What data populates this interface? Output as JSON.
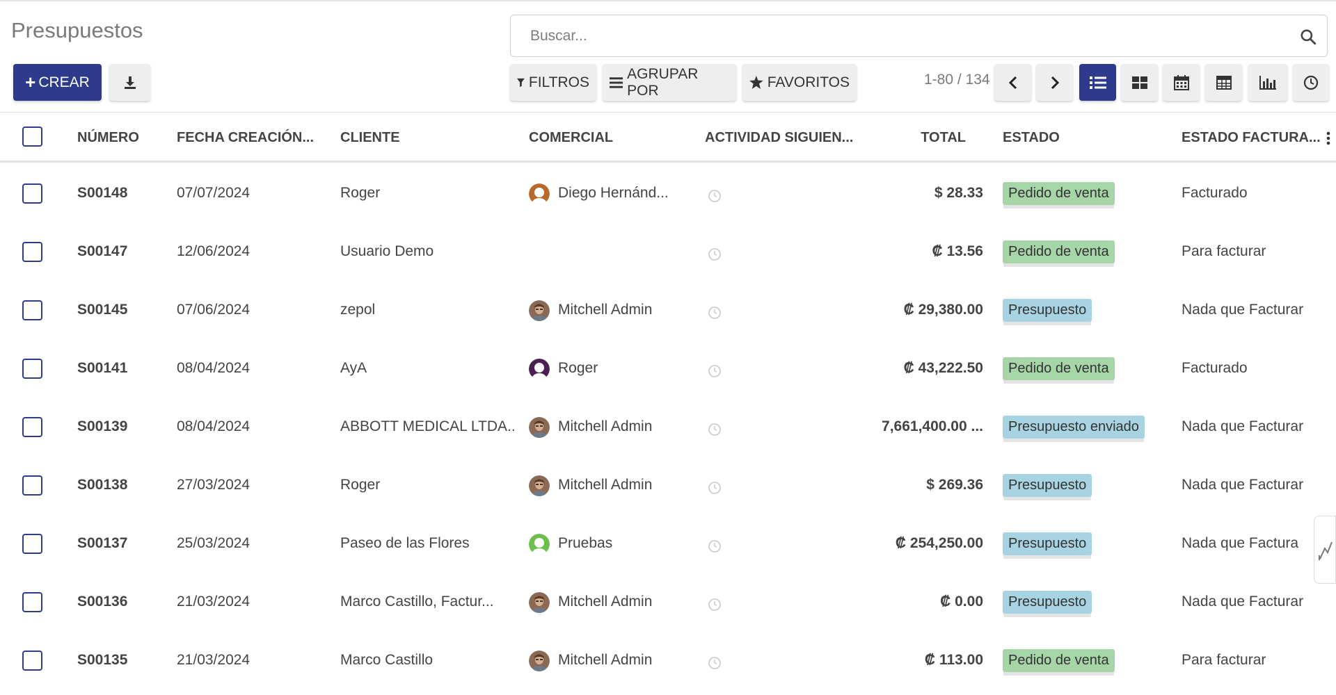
{
  "page": {
    "title": "Presupuestos"
  },
  "search": {
    "placeholder": "Buscar..."
  },
  "toolbar": {
    "create_label": "CREAR",
    "filters_label": "FILTROS",
    "groupby_label": "AGRUPAR POR",
    "favorites_label": "FAVORITOS",
    "pager_text": "1-80 / 134",
    "accent_color": "#2e3b8c"
  },
  "table": {
    "headers": {
      "number": "NÚMERO",
      "created": "FECHA CREACIÓN...",
      "customer": "CLIENTE",
      "salesperson": "COMERCIAL",
      "activity": "ACTIVIDAD SIGUIEN...",
      "total": "TOTAL",
      "status": "ESTADO",
      "invoice_status": "ESTADO FACTURA..."
    },
    "rows": [
      {
        "number": "S00148",
        "date": "07/07/2024",
        "customer": "Roger",
        "salesperson": "Diego Hernánd...",
        "avatar": "orange-user",
        "total": "$ 28.33",
        "status": "Pedido de venta",
        "status_color": "#a6d5a8",
        "invoice": "Facturado"
      },
      {
        "number": "S00147",
        "date": "12/06/2024",
        "customer": "Usuario Demo",
        "salesperson": "",
        "avatar": "",
        "total": "₡ 13.56",
        "status": "Pedido de venta",
        "status_color": "#a6d5a8",
        "invoice": "Para facturar"
      },
      {
        "number": "S00145",
        "date": "07/06/2024",
        "customer": "zepol",
        "salesperson": "Mitchell Admin",
        "avatar": "photo",
        "total": "₡ 29,380.00",
        "status": "Presupuesto",
        "status_color": "#a7d3e2",
        "invoice": "Nada que Facturar"
      },
      {
        "number": "S00141",
        "date": "08/04/2024",
        "customer": "AyA",
        "salesperson": "Roger",
        "avatar": "purple-user",
        "total": "₡ 43,222.50",
        "status": "Pedido de venta",
        "status_color": "#a6d5a8",
        "invoice": "Facturado"
      },
      {
        "number": "S00139",
        "date": "08/04/2024",
        "customer": "ABBOTT MEDICAL LTDA...",
        "salesperson": "Mitchell Admin",
        "avatar": "photo",
        "total": "7,661,400.00 ...",
        "status": "Presupuesto enviado",
        "status_color": "#a7d3e2",
        "invoice": "Nada que Facturar"
      },
      {
        "number": "S00138",
        "date": "27/03/2024",
        "customer": "Roger",
        "salesperson": "Mitchell Admin",
        "avatar": "photo",
        "total": "$ 269.36",
        "status": "Presupuesto",
        "status_color": "#a7d3e2",
        "invoice": "Nada que Facturar"
      },
      {
        "number": "S00137",
        "date": "25/03/2024",
        "customer": "Paseo de las Flores",
        "salesperson": "Pruebas",
        "avatar": "green-user",
        "total": "₡ 254,250.00",
        "status": "Presupuesto",
        "status_color": "#a7d3e2",
        "invoice": "Nada que Factura"
      },
      {
        "number": "S00136",
        "date": "21/03/2024",
        "customer": "Marco Castillo, Factur...",
        "salesperson": "Mitchell Admin",
        "avatar": "photo",
        "total": "₡ 0.00",
        "status": "Presupuesto",
        "status_color": "#a7d3e2",
        "invoice": "Nada que Facturar"
      },
      {
        "number": "S00135",
        "date": "21/03/2024",
        "customer": "Marco Castillo",
        "salesperson": "Mitchell Admin",
        "avatar": "photo",
        "total": "₡ 113.00",
        "status": "Pedido de venta",
        "status_color": "#a6d5a8",
        "invoice": "Para facturar"
      }
    ]
  }
}
